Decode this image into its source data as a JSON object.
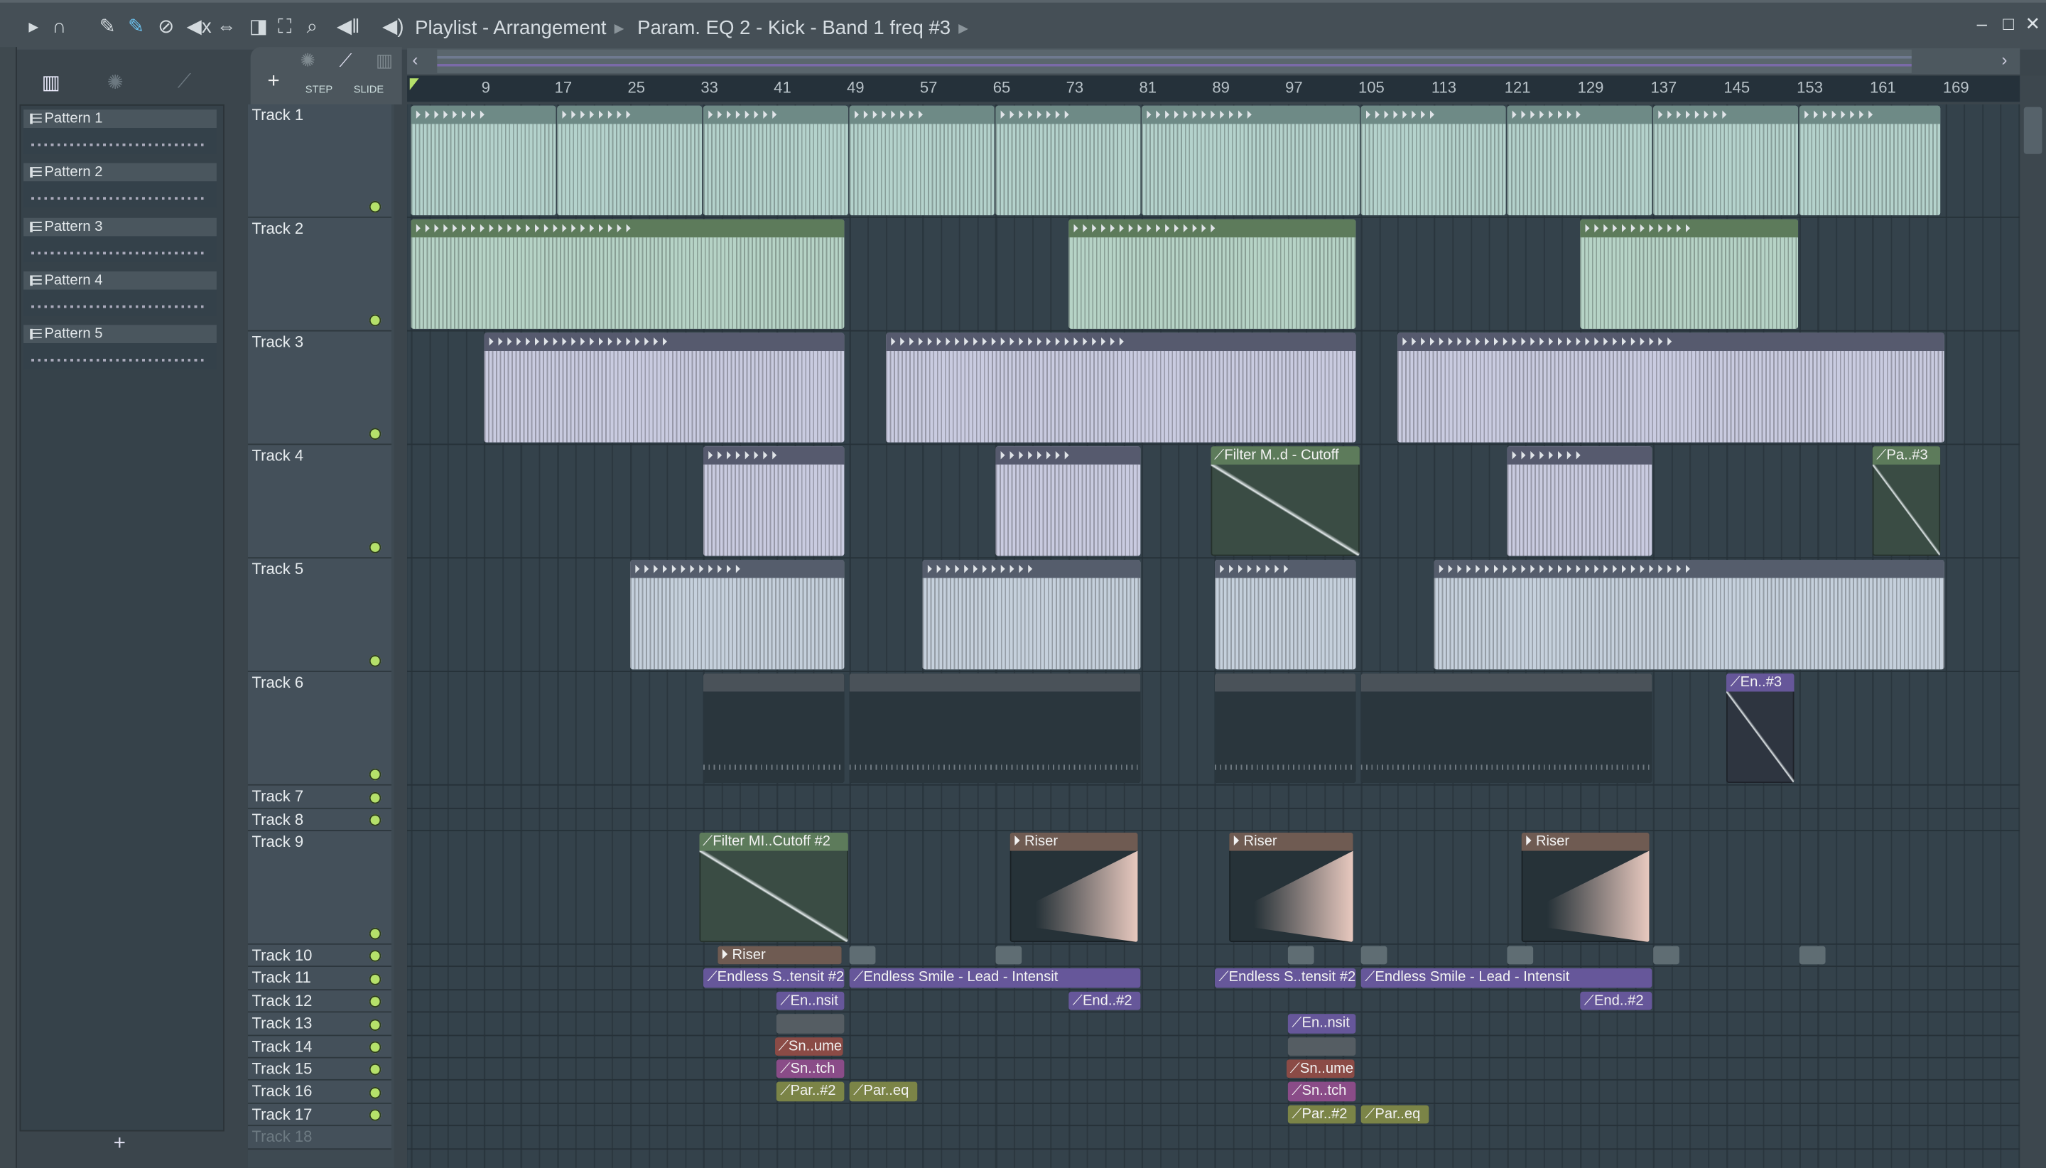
{
  "toolbar": {
    "title": "Playlist - Arrangement",
    "breadcrumb": "Param. EQ 2 - Kick - Band 1 freq #3",
    "icons": [
      "play-arrow-icon",
      "magnet-icon",
      "pencil-icon",
      "paint-icon",
      "delete-icon",
      "mute-icon",
      "slip-icon",
      "slice-icon",
      "select-icon",
      "zoom-icon",
      "playback-icon",
      "speaker-icon"
    ],
    "step_label": "STEP",
    "slide_label": "SLIDE",
    "add_label": "+"
  },
  "window": {
    "minimize": "–",
    "maximize": "□",
    "close": "✕"
  },
  "patterns": [
    "Pattern 1",
    "Pattern 2",
    "Pattern 3",
    "Pattern 4",
    "Pattern 5"
  ],
  "picker_add": "+",
  "ruler": [
    "9",
    "17",
    "25",
    "33",
    "41",
    "49",
    "57",
    "65",
    "73",
    "81",
    "89",
    "97",
    "105",
    "113",
    "121",
    "129",
    "137",
    "145",
    "153",
    "161",
    "169"
  ],
  "tracks": [
    "Track 1",
    "Track 2",
    "Track 3",
    "Track 4",
    "Track 5",
    "Track 6",
    "Track 7",
    "Track 8",
    "Track 9",
    "Track 10",
    "Track 11",
    "Track 12",
    "Track 13",
    "Track 14",
    "Track 15",
    "Track 16",
    "Track 17",
    "Track 18"
  ],
  "colors": {
    "audio_teal": "#b4d2cc",
    "audio_green_hdr": "#5d7b5b",
    "lavender": "#c9cbe0",
    "lav_hdr": "#565a6e",
    "blue": "#c5d0dc",
    "pattern": "#2a363d",
    "automation": "#66579a",
    "red": "#8b4b46",
    "pink": "#8a4c88",
    "olive": "#7b8447",
    "riser": "#6f5b52",
    "accent": "#b5e06a"
  },
  "clips": [
    {
      "t": 0,
      "s": 1,
      "l": 16,
      "k": "teal"
    },
    {
      "t": 0,
      "s": 17,
      "l": 16,
      "k": "teal"
    },
    {
      "t": 0,
      "s": 33,
      "l": 16,
      "k": "teal"
    },
    {
      "t": 0,
      "s": 49,
      "l": 16,
      "k": "teal"
    },
    {
      "t": 0,
      "s": 65,
      "l": 16,
      "k": "teal"
    },
    {
      "t": 0,
      "s": 81,
      "l": 24,
      "k": "teal"
    },
    {
      "t": 0,
      "s": 105,
      "l": 16,
      "k": "teal"
    },
    {
      "t": 0,
      "s": 121,
      "l": 16,
      "k": "teal"
    },
    {
      "t": 0,
      "s": 137,
      "l": 16,
      "k": "teal"
    },
    {
      "t": 0,
      "s": 153,
      "l": 15.5,
      "k": "teal"
    },
    {
      "t": 1,
      "s": 1,
      "l": 47.5,
      "k": "green"
    },
    {
      "t": 1,
      "s": 73,
      "l": 31.5,
      "k": "green"
    },
    {
      "t": 1,
      "s": 129,
      "l": 24,
      "k": "green"
    },
    {
      "t": 2,
      "s": 9,
      "l": 39.5,
      "k": "lav"
    },
    {
      "t": 2,
      "s": 53,
      "l": 51.5,
      "k": "lav"
    },
    {
      "t": 2,
      "s": 109,
      "l": 60,
      "k": "lav"
    },
    {
      "t": 3,
      "s": 33,
      "l": 15.5,
      "k": "lav"
    },
    {
      "t": 3,
      "s": 65,
      "l": 16,
      "k": "lav"
    },
    {
      "t": 3,
      "s": 88.5,
      "l": 16.5,
      "k": "autog",
      "label": "Filter M..d - Cutoff"
    },
    {
      "t": 3,
      "s": 121,
      "l": 16,
      "k": "lav"
    },
    {
      "t": 3,
      "s": 161,
      "l": 7.5,
      "k": "autog",
      "label": "Pa..#3"
    },
    {
      "t": 4,
      "s": 25,
      "l": 23.5,
      "k": "blue"
    },
    {
      "t": 4,
      "s": 57,
      "l": 24,
      "k": "blue"
    },
    {
      "t": 4,
      "s": 89,
      "l": 15.5,
      "k": "blue"
    },
    {
      "t": 4,
      "s": 113,
      "l": 56,
      "k": "blue"
    },
    {
      "t": 5,
      "s": 33,
      "l": 15.5,
      "k": "pat"
    },
    {
      "t": 5,
      "s": 49,
      "l": 32,
      "k": "pat"
    },
    {
      "t": 5,
      "s": 89,
      "l": 15.5,
      "k": "pat"
    },
    {
      "t": 5,
      "s": 105,
      "l": 32,
      "k": "pat"
    },
    {
      "t": 5,
      "s": 145,
      "l": 7.5,
      "k": "autop",
      "label": "En..#3"
    },
    {
      "t": 8,
      "s": 32.5,
      "l": 16.5,
      "k": "autog",
      "label": "Filter MI..Cutoff #2"
    },
    {
      "t": 8,
      "s": 66.5,
      "l": 14.2,
      "k": "riser",
      "label": "Riser"
    },
    {
      "t": 8,
      "s": 90.5,
      "l": 13.8,
      "k": "riser",
      "label": "Riser"
    },
    {
      "t": 8,
      "s": 122.5,
      "l": 14.2,
      "k": "riser",
      "label": "Riser"
    },
    {
      "t": 9,
      "s": 34.5,
      "l": 13.8,
      "k": "riser",
      "label": "Riser"
    },
    {
      "t": 9,
      "s": 49,
      "l": 3,
      "k": "small"
    },
    {
      "t": 9,
      "s": 65,
      "l": 3,
      "k": "small"
    },
    {
      "t": 9,
      "s": 97,
      "l": 3,
      "k": "small"
    },
    {
      "t": 9,
      "s": 105,
      "l": 3,
      "k": "small"
    },
    {
      "t": 9,
      "s": 121,
      "l": 3,
      "k": "small"
    },
    {
      "t": 9,
      "s": 137,
      "l": 3,
      "k": "small"
    },
    {
      "t": 9,
      "s": 153,
      "l": 3,
      "k": "small"
    },
    {
      "t": 10,
      "s": 33,
      "l": 15.5,
      "k": "auto",
      "label": "Endless S..tensit #2"
    },
    {
      "t": 10,
      "s": 49,
      "l": 32,
      "k": "auto",
      "label": "Endless Smile - Lead - Intensit"
    },
    {
      "t": 10,
      "s": 89,
      "l": 15.5,
      "k": "auto",
      "label": "Endless S..tensit #2"
    },
    {
      "t": 10,
      "s": 105,
      "l": 32,
      "k": "auto",
      "label": "Endless Smile - Lead - Intensit"
    },
    {
      "t": 11,
      "s": 41,
      "l": 7.5,
      "k": "auto",
      "label": "En..nsit"
    },
    {
      "t": 11,
      "s": 73,
      "l": 8,
      "k": "auto",
      "label": "End..#2"
    },
    {
      "t": 11,
      "s": 129,
      "l": 8,
      "k": "auto",
      "label": "End..#2"
    },
    {
      "t": 12,
      "s": 41,
      "l": 7.5,
      "k": "patg"
    },
    {
      "t": 12,
      "s": 97,
      "l": 7.5,
      "k": "auto",
      "label": "En..nsit"
    },
    {
      "t": 13,
      "s": 40.8,
      "l": 7.7,
      "k": "red",
      "label": "Sn..ume"
    },
    {
      "t": 13,
      "s": 97,
      "l": 7.5,
      "k": "patg"
    },
    {
      "t": 14,
      "s": 41,
      "l": 7.5,
      "k": "pink",
      "label": "Sn..tch"
    },
    {
      "t": 14,
      "s": 96.8,
      "l": 7.7,
      "k": "red",
      "label": "Sn..ume"
    },
    {
      "t": 15,
      "s": 41,
      "l": 7.5,
      "k": "olive",
      "label": "Par..#2"
    },
    {
      "t": 15,
      "s": 49,
      "l": 7.5,
      "k": "olive",
      "label": "Par..eq"
    },
    {
      "t": 15,
      "s": 97,
      "l": 7.5,
      "k": "pink",
      "label": "Sn..tch"
    },
    {
      "t": 16,
      "s": 97,
      "l": 7.5,
      "k": "olive",
      "label": "Par..#2"
    },
    {
      "t": 16,
      "s": 105,
      "l": 7.5,
      "k": "olive",
      "label": "Par..eq"
    }
  ]
}
